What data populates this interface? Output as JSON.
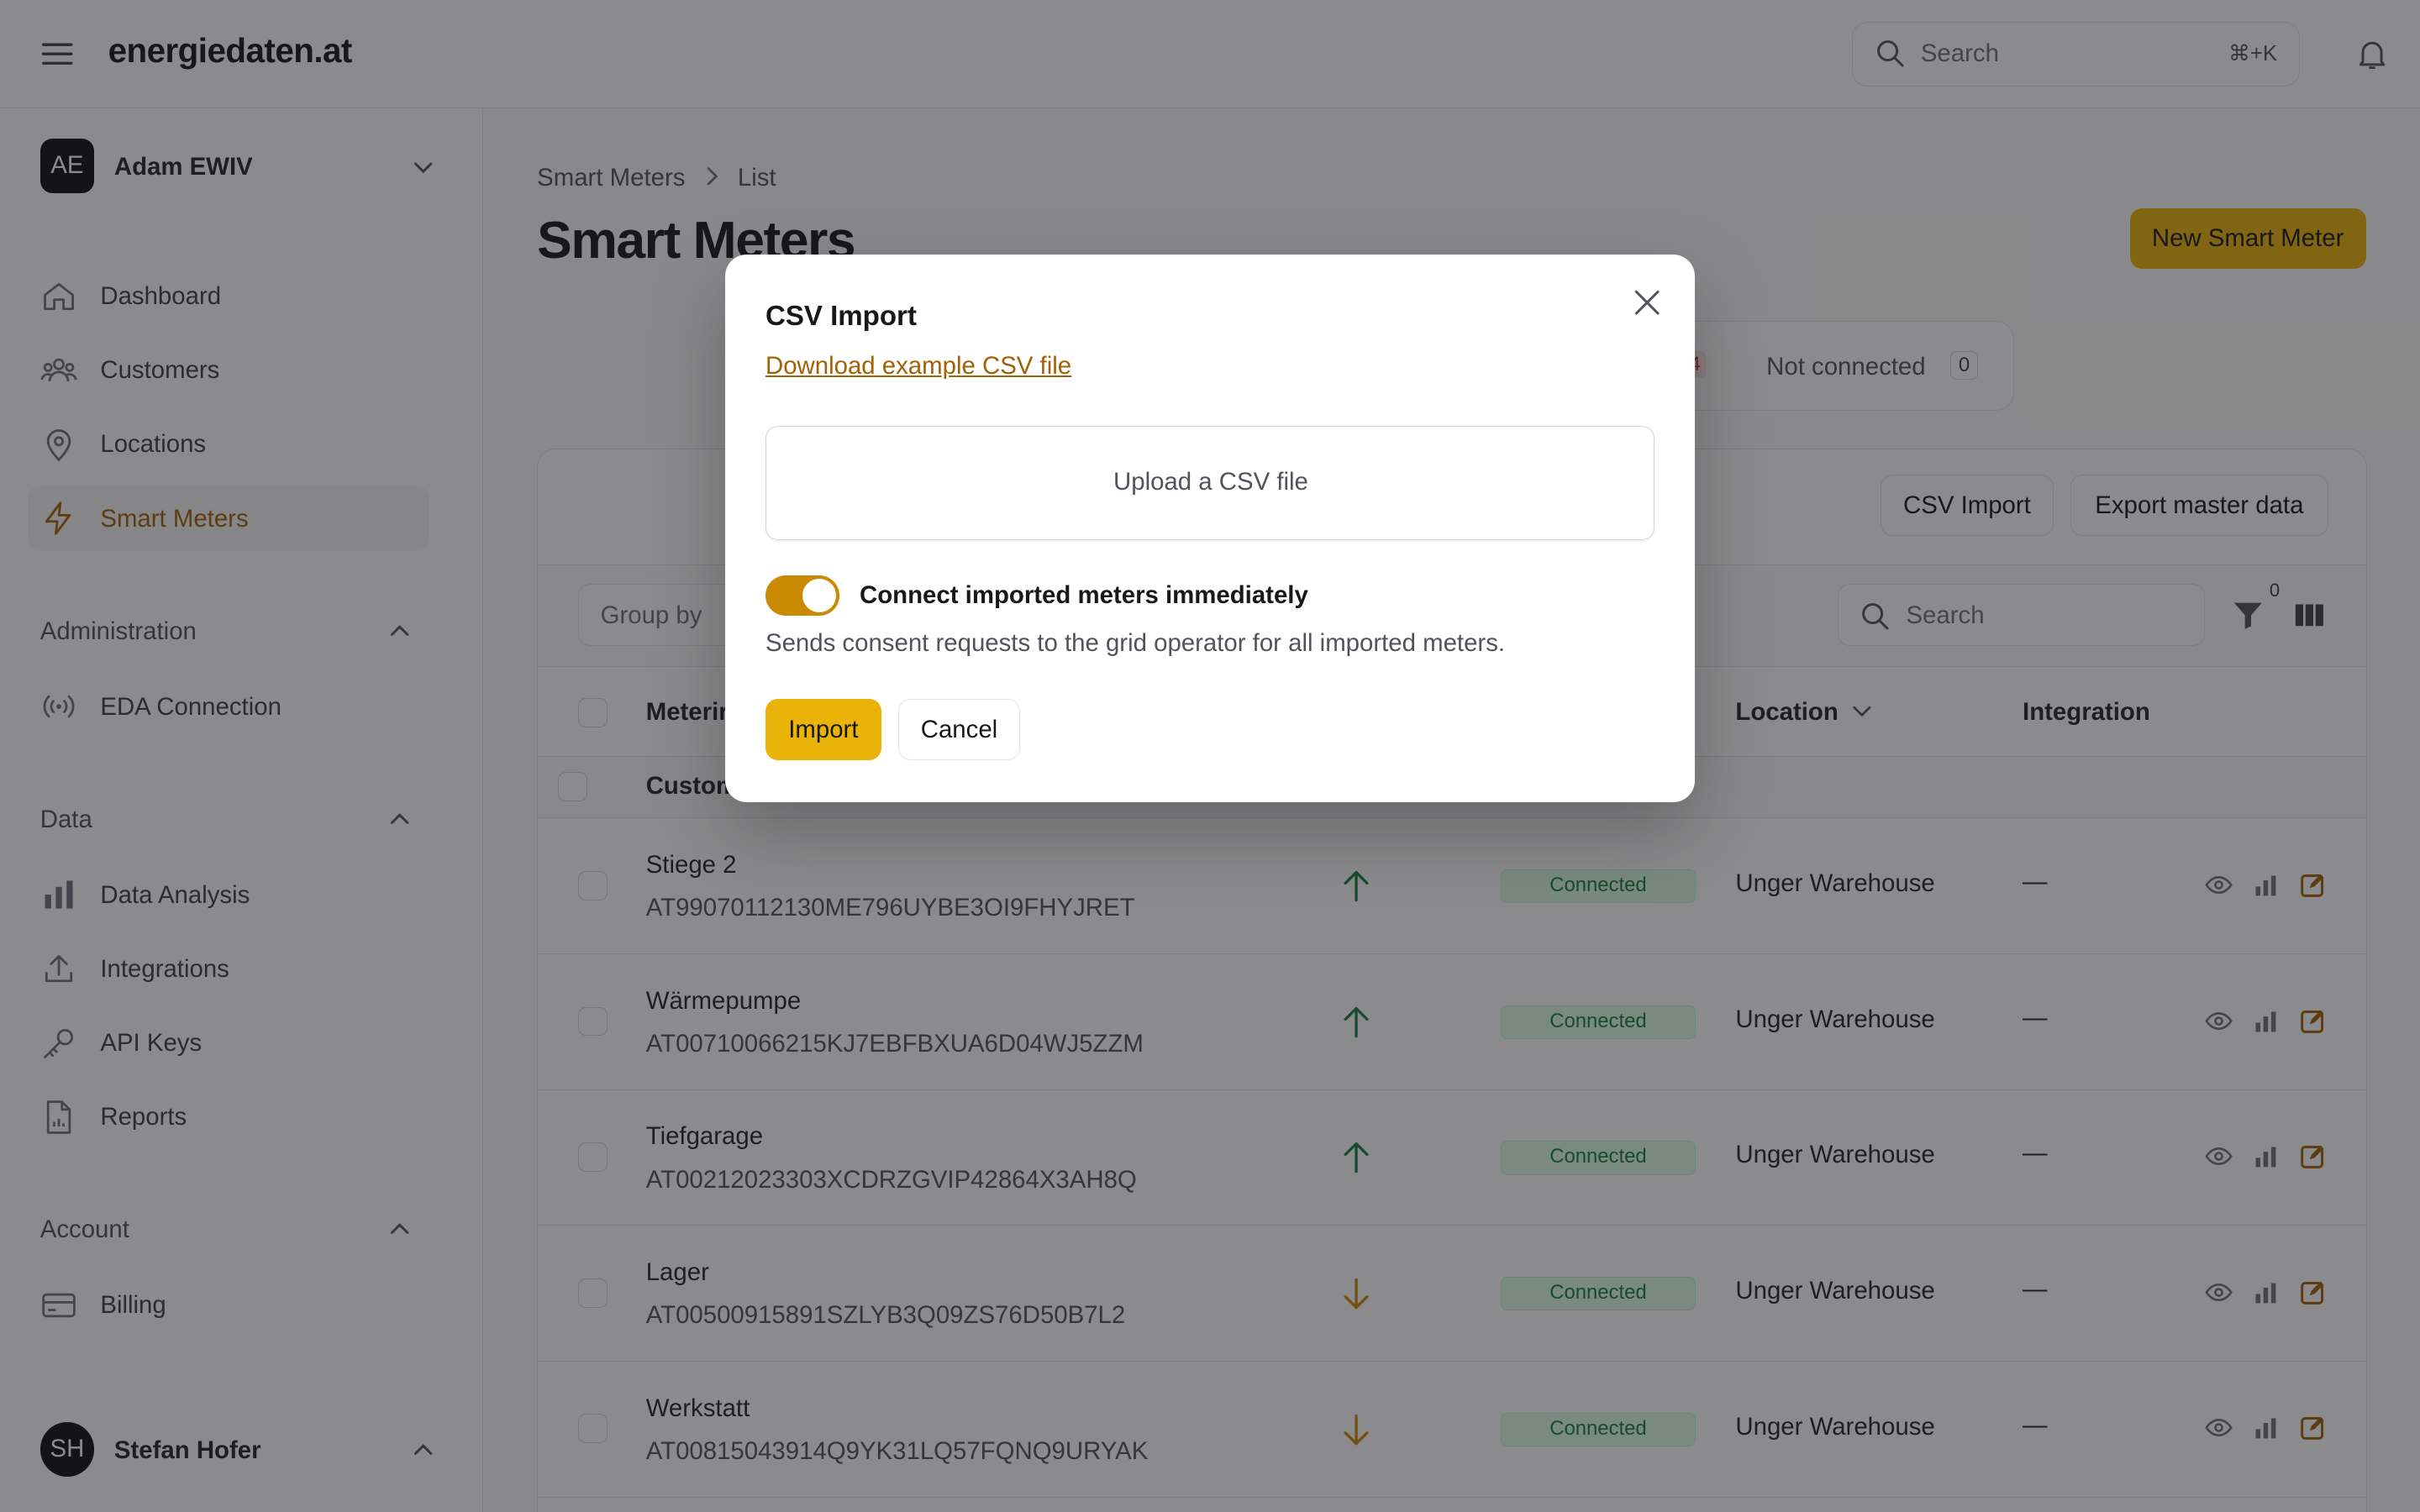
{
  "app": {
    "brand": "energiedaten.at",
    "search_placeholder": "Search",
    "search_shortcut": "⌘+K"
  },
  "sidebar": {
    "team": {
      "initials": "AE",
      "name": "Adam EWIV"
    },
    "nav": [
      {
        "label": "Dashboard",
        "icon": "home-icon"
      },
      {
        "label": "Customers",
        "icon": "users-icon"
      },
      {
        "label": "Locations",
        "icon": "map-pin-icon"
      },
      {
        "label": "Smart Meters",
        "icon": "bolt-icon",
        "active": true
      }
    ],
    "sections": [
      {
        "title": "Administration",
        "items": [
          {
            "label": "EDA Connection",
            "icon": "signal-icon"
          }
        ]
      },
      {
        "title": "Data",
        "items": [
          {
            "label": "Data Analysis",
            "icon": "bar-chart-icon"
          },
          {
            "label": "Integrations",
            "icon": "upload-icon"
          },
          {
            "label": "API Keys",
            "icon": "key-icon"
          },
          {
            "label": "Reports",
            "icon": "report-icon"
          }
        ]
      },
      {
        "title": "Account",
        "items": [
          {
            "label": "Billing",
            "icon": "credit-card-icon"
          }
        ]
      }
    ],
    "user": {
      "initials": "SH",
      "name": "Stefan Hofer"
    }
  },
  "main": {
    "breadcrumb": [
      "Smart Meters",
      "List"
    ],
    "title": "Smart Meters",
    "new_button": "New Smart Meter",
    "tabs": {
      "partial_count": "4",
      "not_connected_label": "Not connected",
      "not_connected_count": "0"
    },
    "actions": {
      "csv_import": "CSV Import",
      "export": "Export master data"
    },
    "toolbar": {
      "group_by": "Group by",
      "search_placeholder": "Search",
      "filter_count": "0"
    },
    "columns": {
      "metering": "Meterir",
      "location": "Location",
      "integration": "Integration"
    },
    "group_label": "Custom",
    "rows": [
      {
        "name": "Stiege 2",
        "id": "AT99070112130ME796UYBE3OI9FHYJRET",
        "direction": "up",
        "status": "Connected",
        "location": "Unger Warehouse",
        "integration": "—"
      },
      {
        "name": "Wärmepumpe",
        "id": "AT00710066215KJ7EBFBXUA6D04WJ5ZZM",
        "direction": "up",
        "status": "Connected",
        "location": "Unger Warehouse",
        "integration": "—"
      },
      {
        "name": "Tiefgarage",
        "id": "AT00212023303XCDRZGVIP42864X3AH8Q",
        "direction": "up",
        "status": "Connected",
        "location": "Unger Warehouse",
        "integration": "—"
      },
      {
        "name": "Lager",
        "id": "AT00500915891SZLYB3Q09ZS76D50B7L2",
        "direction": "down",
        "status": "Connected",
        "location": "Unger Warehouse",
        "integration": "—"
      },
      {
        "name": "Werkstatt",
        "id": "AT00815043914Q9YK31LQ57FQNQ9URYAK",
        "direction": "down",
        "status": "Connected",
        "location": "Unger Warehouse",
        "integration": "—"
      }
    ]
  },
  "modal": {
    "title": "CSV Import",
    "download_link": "Download example CSV file",
    "upload_label": "Upload a CSV file",
    "toggle_label": "Connect imported meters immediately",
    "toggle_on": true,
    "help_text": "Sends consent requests to the grid operator for all imported meters.",
    "import_button": "Import",
    "cancel_button": "Cancel"
  },
  "colors": {
    "accent": "#eab308",
    "accent_dark": "#ca8a04",
    "link": "#a16207",
    "connected_bg": "#dcfce7",
    "connected_text": "#15803d",
    "up_arrow": "#15803d",
    "down_arrow": "#ca8a04"
  }
}
